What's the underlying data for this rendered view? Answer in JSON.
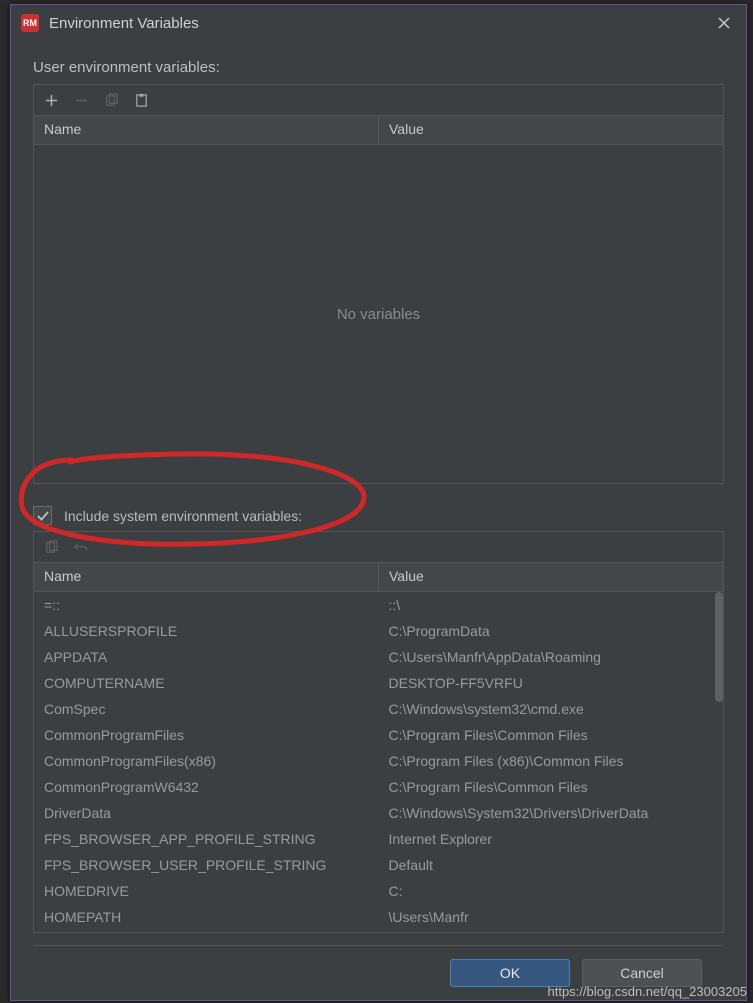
{
  "dialog": {
    "title": "Environment Variables",
    "app_icon_text": "RM"
  },
  "user_section": {
    "label": "User environment variables:",
    "columns": {
      "name": "Name",
      "value": "Value"
    },
    "empty_text": "No variables"
  },
  "include_system": {
    "label": "Include system environment variables:",
    "checked": true
  },
  "sys_section": {
    "columns": {
      "name": "Name",
      "value": "Value"
    },
    "rows": [
      {
        "name": "=::",
        "value": "::\\"
      },
      {
        "name": "ALLUSERSPROFILE",
        "value": "C:\\ProgramData"
      },
      {
        "name": "APPDATA",
        "value": "C:\\Users\\Manfr\\AppData\\Roaming"
      },
      {
        "name": "COMPUTERNAME",
        "value": "DESKTOP-FF5VRFU"
      },
      {
        "name": "ComSpec",
        "value": "C:\\Windows\\system32\\cmd.exe"
      },
      {
        "name": "CommonProgramFiles",
        "value": "C:\\Program Files\\Common Files"
      },
      {
        "name": "CommonProgramFiles(x86)",
        "value": "C:\\Program Files (x86)\\Common Files"
      },
      {
        "name": "CommonProgramW6432",
        "value": "C:\\Program Files\\Common Files"
      },
      {
        "name": "DriverData",
        "value": "C:\\Windows\\System32\\Drivers\\DriverData"
      },
      {
        "name": "FPS_BROWSER_APP_PROFILE_STRING",
        "value": "Internet Explorer"
      },
      {
        "name": "FPS_BROWSER_USER_PROFILE_STRING",
        "value": "Default"
      },
      {
        "name": "HOMEDRIVE",
        "value": "C:"
      },
      {
        "name": "HOMEPATH",
        "value": "\\Users\\Manfr"
      }
    ]
  },
  "buttons": {
    "ok": "OK",
    "cancel": "Cancel"
  },
  "watermark": "https://blog.csdn.net/qq_23003205"
}
